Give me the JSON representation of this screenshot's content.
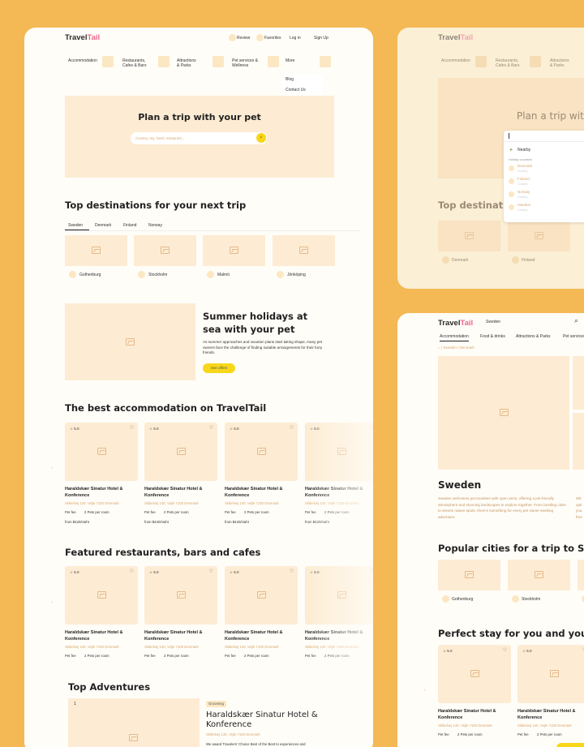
{
  "brand": {
    "travel": "Travel",
    "tail": "Tail"
  },
  "p1": {
    "header": {
      "review": "Review",
      "favorites": "Favorites",
      "login": "Log in",
      "signup": "Sign Up"
    },
    "nav": [
      {
        "label": "Accommodation"
      },
      {
        "label": "Restaurants,\nCafes & Bars"
      },
      {
        "label": "Attractions\n& Parks"
      },
      {
        "label": "Pet services &\nWellness"
      },
      {
        "label": "More"
      }
    ],
    "more_menu": [
      "Blog",
      "Contact Us"
    ],
    "hero": {
      "title": "Plan a trip with your pet",
      "search_placeholder": "Country, city, hotel, restaurant..."
    },
    "destinations": {
      "title": "Top destinations for your next trip",
      "tabs": [
        "Sweden",
        "Denmark",
        "Finland",
        "Norway"
      ],
      "cities": [
        "Gothenburg",
        "Stockholm",
        "Malmö",
        "Jönköping"
      ]
    },
    "promo": {
      "title": "Summer holidays at\nsea with your pet",
      "body": "As summer approaches and vacation plans start taking shape, many pet owners face the challenge of finding suitable arrangements for their furry friends.",
      "button": "See offers"
    },
    "accommodation": {
      "title": "The best accommodation on TravelTail",
      "cards": [
        {
          "rating": "5.0",
          "name": "Haraldskær Sinatur Hotel & Konference",
          "address": "Skibelvej 140, Vejle 7100 Denmark",
          "pet_fee": "Pet fee",
          "pets": "2 Pets per room",
          "price": "from $420/night"
        },
        {
          "rating": "5.0",
          "name": "Haraldskær Sinatur Hotel & Konference",
          "address": "Skibelvej 140, Vejle 7100 Denmark",
          "pet_fee": "Pet fee",
          "pets": "2 Pets per room",
          "price": "from $420/night"
        },
        {
          "rating": "5.0",
          "name": "Haraldskær Sinatur Hotel & Konference",
          "address": "Skibelvej 140, Vejle 7100 Denmark",
          "pet_fee": "Pet fee",
          "pets": "2 Pets per room",
          "price": "from $420/night"
        },
        {
          "rating": "5.0",
          "name": "Haraldskær Sinatur Hotel & Konference",
          "address": "Skibelvej 140, Vejle 7100 Denmark",
          "pet_fee": "Pet fee",
          "pets": "2 Pets per room",
          "price": "from $420/night"
        }
      ]
    },
    "restaurants": {
      "title": "Featured restaurants, bars and cafes",
      "cards": [
        {
          "rating": "5.0",
          "name": "Haraldskær Sinatur Hotel & Konference",
          "address": "Skibelvej 140, Vejle 7100 Denmark",
          "pet_fee": "Pet fee",
          "pets": "2 Pets per room"
        },
        {
          "rating": "5.0",
          "name": "Haraldskær Sinatur Hotel & Konference",
          "address": "Skibelvej 140, Vejle 7100 Denmark",
          "pet_fee": "Pet fee",
          "pets": "2 Pets per room"
        },
        {
          "rating": "5.0",
          "name": "Haraldskær Sinatur Hotel & Konference",
          "address": "Skibelvej 140, Vejle 7100 Denmark",
          "pet_fee": "Pet fee",
          "pets": "2 Pets per room"
        },
        {
          "rating": "5.0",
          "name": "Haraldskær Sinatur Hotel & Konference",
          "address": "Skibelvej 140, Vejle 7100 Denmark",
          "pet_fee": "Pet fee",
          "pets": "2 Pets per room"
        }
      ]
    },
    "adventures": {
      "title": "Top Adventures",
      "index": "1",
      "badge": "Grooming",
      "name": "Haraldskær Sinatur Hotel &\nKonference",
      "address": "Skibelvej 140, Vejle 7100 Denmark",
      "desc": "We award Travelers' Choice Best of the Best to experiences and"
    }
  },
  "p2": {
    "nav": [
      {
        "label": "Accommodation"
      },
      {
        "label": "Restaurants,\nCafes & Bars"
      },
      {
        "label": "Attractions\n& Parks"
      }
    ],
    "hero_title": "Plan a trip with",
    "dropdown": {
      "first": "Nearby",
      "heading": "Holiday countries",
      "items": [
        {
          "name": "Denmark",
          "sub": "Country"
        },
        {
          "name": "Finland",
          "sub": "Country"
        },
        {
          "name": "Norway",
          "sub": "Country"
        },
        {
          "name": "Sweden",
          "sub": "Country"
        }
      ]
    },
    "section_title": "Top destinatio",
    "cities": [
      "Denmark",
      "Finland"
    ]
  },
  "p3": {
    "search_value": "Sweden",
    "nav": [
      "Accommodation",
      "Food & drinks",
      "Attractions & Parks",
      "Pet services"
    ],
    "breadcrumb": "/ Sweden / Denmark",
    "country": "Sweden",
    "intro": "Sweden welcomes pet travelers with open arms, offering a pet-friendly atmosphere and stunning landscapes to explore together. From bustling cities to serene nature spots, there's something for every pet owner seeking adventure.",
    "intro2": "Wit\nopti\nyou\nfree",
    "cities_title": "Popular cities for a trip to Sweden",
    "cities": [
      "Gothenburg",
      "Stockholm"
    ],
    "stay_title": "Perfect stay for you and your furry",
    "cards": [
      {
        "rating": "5.0",
        "name": "Haraldskær Sinatur Hotel & Konference",
        "address": "Skibelvej 140, Vejle 7100 Denmark",
        "pet_fee": "Pet fee",
        "pets": "2 Pets per room"
      },
      {
        "rating": "5.0",
        "name": "Haraldskær Sinatur Hotel & Konference",
        "address": "Skibelvej 140, Vejle 7100 Denmark",
        "pet_fee": "Pet fee",
        "pets": "2 Pets per room"
      }
    ]
  },
  "colors": {
    "background": "#f4b954",
    "cream": "#fdecd3",
    "yellow": "#f8d71b",
    "brand_pink": "#e8688b"
  }
}
